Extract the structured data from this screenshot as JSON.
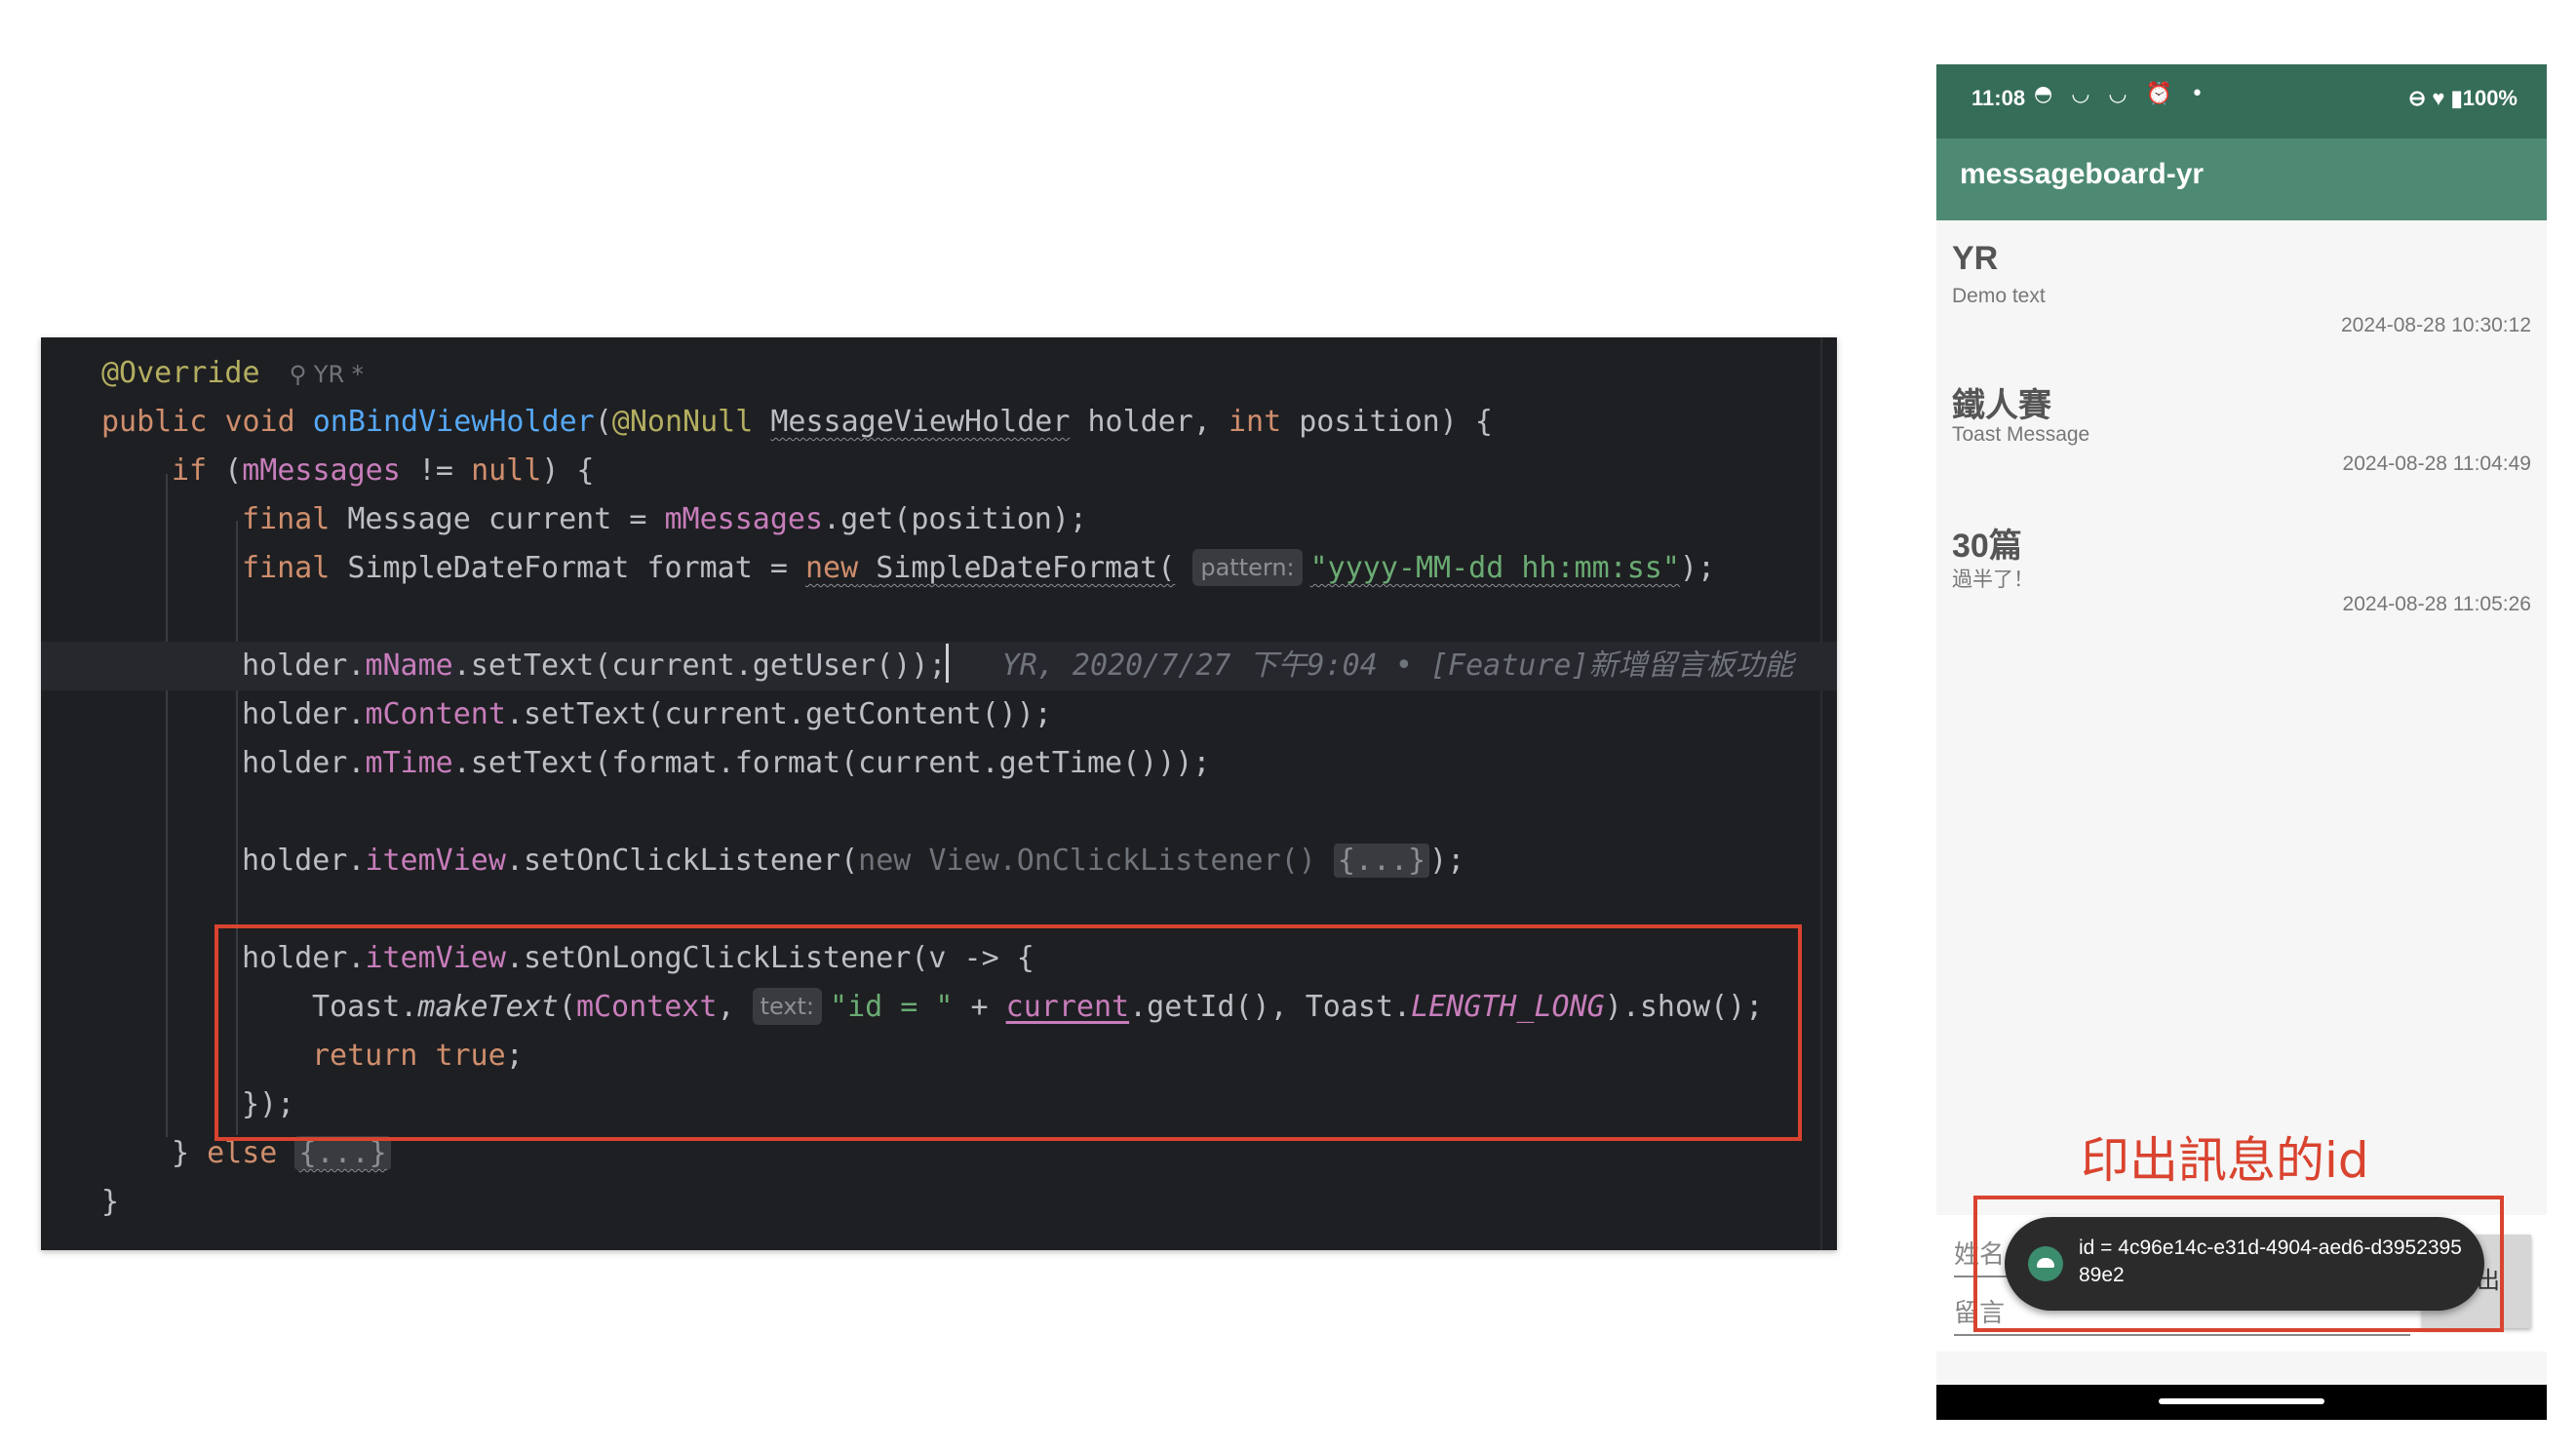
{
  "editor": {
    "author_label": "YR *",
    "lines": {
      "l1_ann": "@Override",
      "l2_public": "public",
      "l2_void": "void",
      "l2_fn": "onBindViewHolder",
      "l2_nonnull": "@NonNull",
      "l2_type": "MessageViewHolder",
      "l2_rest1": " holder, ",
      "l2_int": "int",
      "l2_rest2": " position) {",
      "l3_if": "if",
      "l3_field": "mMessages",
      "l3_ne": " != ",
      "l3_null": "null",
      "l3_end": ") {",
      "l4_final": "final",
      "l4_text": " Message current = ",
      "l4_field": "mMessages",
      "l4_end": ".get(position);",
      "l5_final": "final",
      "l5_text": " SimpleDateFormat format = ",
      "l5_new": "new",
      "l5_ctor": "SimpleDateFormat(",
      "l5_hint": "pattern:",
      "l5_str": "\"yyyy-MM-dd hh:mm:ss\"",
      "l5_end": ");",
      "l7_holder": "holder.",
      "l7_field": "mName",
      "l7_end": ".setText(current.getUser());",
      "l7_blame": "YR, 2020/7/27 下午9:04 • [Feature]新增留言板功能",
      "l8_holder": "holder.",
      "l8_field": "mContent",
      "l8_end": ".setText(current.getContent());",
      "l9_holder": "holder.",
      "l9_field": "mTime",
      "l9_end": ".setText(format.format(current.getTime()));",
      "l11_holder": "holder.",
      "l11_field": "itemView",
      "l11_call": ".setOnClickListener(",
      "l11_grey": "new View.OnClickListener() ",
      "l11_fold": "{...}",
      "l11_end": ");",
      "l13_holder": "holder.",
      "l13_field": "itemView",
      "l13_end": ".setOnLongClickListener(v -> {",
      "l14_toast": "Toast.",
      "l14_make": "makeText",
      "l14_paren": "(",
      "l14_ctx": "mContext",
      "l14_comma": ", ",
      "l14_hint": "text:",
      "l14_str": "\"id = \"",
      "l14_plus": " + ",
      "l14_current": "current",
      "l14_getid": ".getId(), Toast.",
      "l14_len": "LENGTH_LONG",
      "l14_end": ").show();",
      "l15_return": "return",
      "l15_true": "true",
      "l15_end": ";",
      "l16": "});",
      "l17_close": "} ",
      "l17_else": "else",
      "l17_fold": "{...}",
      "l18": "}"
    }
  },
  "phone": {
    "status_time": "11:08",
    "status_icons": "◓ ◡ ◡ ⏰ •",
    "status_right": "⊖ ♥ ▮100%",
    "app_title": "messageboard-yr",
    "messages": [
      {
        "user": "YR",
        "content": "Demo text",
        "time": "2024-08-28 10:30:12"
      },
      {
        "user": "鐵人賽",
        "content": "Toast Message",
        "time": "2024-08-28 11:04:49"
      },
      {
        "user": "30篇",
        "content": "過半了！",
        "time": "2024-08-28 11:05:26"
      }
    ],
    "name_hint": "姓名",
    "message_hint": "留言",
    "send_label": "送出",
    "toast_text": "id = 4c96e14c-e31d-4904-aed6-d395239589e2"
  },
  "annotation": {
    "caption": "印出訊息的id",
    "highlight_color": "#d9432f"
  }
}
